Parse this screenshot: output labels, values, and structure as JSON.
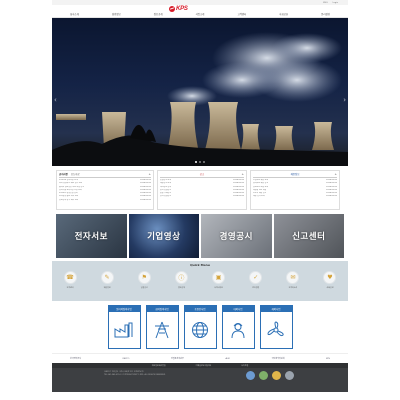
{
  "util": {
    "links": [
      "ENG",
      "Login"
    ]
  },
  "header": {
    "logo_text": "KPS",
    "nav": [
      "회사소개",
      "경영정보",
      "정보공개",
      "사업소개",
      "고객센터",
      "사회공헌",
      "윤리경영"
    ]
  },
  "hero": {
    "prev": "‹",
    "next": "›"
  },
  "board_main": {
    "tabs": [
      "공지사항",
      "보도자료"
    ],
    "rows": [
      {
        "title": "한전KPS 공지사항 안내",
        "date": "2024.00.00"
      },
      {
        "title": "사내 경영혁신 제안 접수 안내",
        "date": "2024.00.00"
      },
      {
        "title": "협력사 동반성장 지원 사업 공고",
        "date": "2024.00.00"
      },
      {
        "title": "정비기술 교육과정 신청 안내",
        "date": "2024.00.00"
      },
      {
        "title": "안전보건 경영방침 공지",
        "date": "2024.00.00"
      },
      {
        "title": "윤리경영 실천 서약 안내",
        "date": "2024.00.00"
      },
      {
        "title": "정보공개 청구 처리 안내",
        "date": "2024.00.00"
      }
    ]
  },
  "board_side": {
    "title": "공고",
    "rows": [
      {
        "title": "입찰공고 안내",
        "date": "2024.00.00"
      },
      {
        "title": "채용공고 안내",
        "date": "2024.00.00"
      },
      {
        "title": "계약정보 공개",
        "date": "2024.00.00"
      },
      {
        "title": "용역 입찰공고",
        "date": "2024.00.00"
      },
      {
        "title": "물품 구매공고",
        "date": "2024.00.00"
      },
      {
        "title": "공사 입찰공고",
        "date": "2024.00.00"
      }
    ]
  },
  "board_side2": {
    "title": "채용정보",
    "rows": [
      {
        "title": "신입사원 채용 안내",
        "date": "2024.00.00"
      },
      {
        "title": "경력사원 채용 공고",
        "date": "2024.00.00"
      },
      {
        "title": "청년인턴 모집 안내",
        "date": "2024.00.00"
      },
      {
        "title": "체험형 인턴 채용",
        "date": "2024.00.00"
      },
      {
        "title": "전문직 채용 공고",
        "date": "2024.00.00"
      },
      {
        "title": "채용 결과 안내",
        "date": "2024.00.00"
      }
    ]
  },
  "tiles": [
    "전자서보",
    "기업영상",
    "경영공시",
    "신고센터"
  ],
  "quick": {
    "title": "Quick Menu",
    "items": [
      "고객센터",
      "채용정보",
      "입찰공고",
      "정보공개",
      "사이버홍보",
      "윤리경영",
      "고객의소리",
      "사회공헌"
    ],
    "icons": [
      "☎",
      "✎",
      "⚑",
      "ⓘ",
      "▣",
      "✓",
      "✉",
      "♥"
    ]
  },
  "business": [
    "원자력정비사업",
    "화력정비사업",
    "송변전사업",
    "대외사업",
    "해외사업"
  ],
  "partners": [
    "한국전력공사",
    "KEPCO",
    "산업통상자원부",
    "ALIO",
    "국민권익위원회",
    "KPS"
  ],
  "footer": {
    "links": [
      "개인정보처리방침",
      "이메일무단수집거부",
      "사이트맵"
    ],
    "info": [
      "(58217) 전라남도 나주시 문화로 211 한전KPS(주)",
      "TEL 061-345-0114 / COPYRIGHT KEPCO KPS. ALL RIGHTS RESERVED."
    ]
  },
  "colors": {
    "accent": "#d71a28",
    "brand_blue": "#2b6fb5",
    "quick_bg": "#cfd9df",
    "footer_bg": "#3d3f42"
  }
}
